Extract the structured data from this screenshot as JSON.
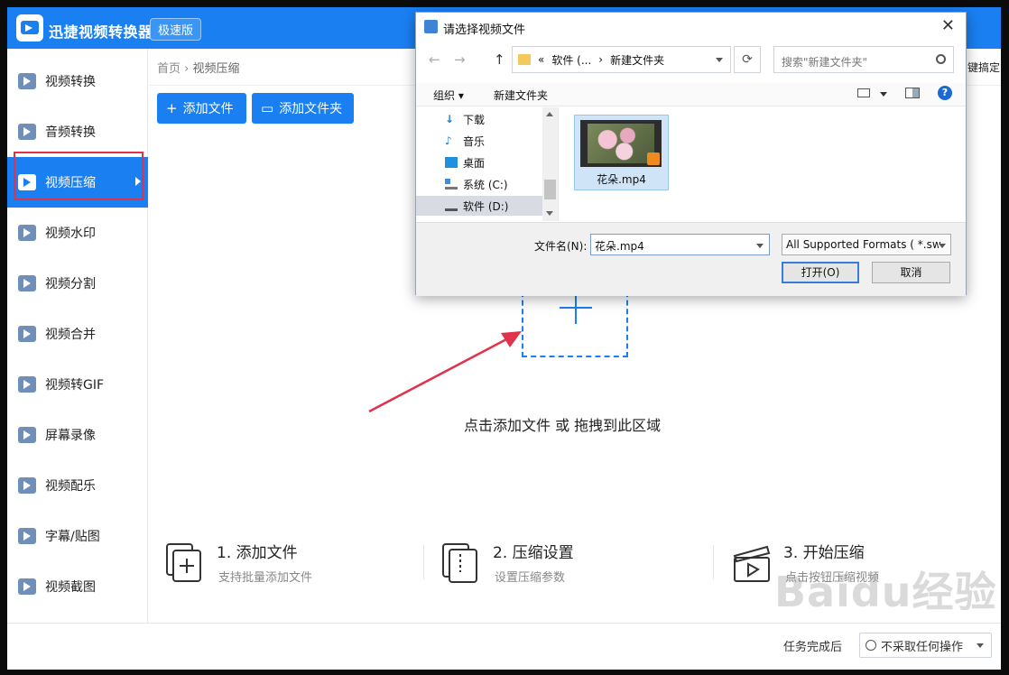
{
  "app": {
    "title": "迅捷视频转换器",
    "edition": "极速版"
  },
  "sidebar": {
    "items": [
      {
        "label": "视频转换"
      },
      {
        "label": "音频转换"
      },
      {
        "label": "视频压缩",
        "active": true
      },
      {
        "label": "视频水印"
      },
      {
        "label": "视频分割"
      },
      {
        "label": "视频合并"
      },
      {
        "label": "视频转GIF"
      },
      {
        "label": "屏幕录像"
      },
      {
        "label": "视频配乐"
      },
      {
        "label": "字幕/贴图"
      },
      {
        "label": "视频截图"
      }
    ],
    "active_outline_color": "#e0324a"
  },
  "breadcrumb": {
    "home": "首页",
    "sep": "›",
    "current": "视频压缩"
  },
  "toolbar": {
    "add_file": "添加文件",
    "add_folder": "添加文件夹",
    "right_cut_text": "键搞定"
  },
  "dropzone": {
    "text": "点击添加文件 或 拖拽到此区域"
  },
  "steps": [
    {
      "title": "1. 添加文件",
      "desc": "支持批量添加文件"
    },
    {
      "title": "2. 压缩设置",
      "desc": "设置压缩参数"
    },
    {
      "title": "3. 开始压缩",
      "desc": "点击按钮压缩视频"
    }
  ],
  "bottom": {
    "status_label": "任务完成后",
    "select_value": "不采取任何操作"
  },
  "watermark": "Baidu经验",
  "dialog": {
    "title": "请选择视频文件",
    "address": {
      "prefix": "«",
      "part1": "软件 (...",
      "sep": "›",
      "part2": "新建文件夹"
    },
    "search_placeholder": "搜索\"新建文件夹\"",
    "toolbar": {
      "organize": "组织 ▾",
      "new_folder": "新建文件夹",
      "help": "?"
    },
    "tree": [
      {
        "label": "下载",
        "icon": "download-icon"
      },
      {
        "label": "音乐",
        "icon": "music-icon"
      },
      {
        "label": "桌面",
        "icon": "desktop-icon"
      },
      {
        "label": "系统 (C:)",
        "icon": "drive-icon"
      },
      {
        "label": "软件 (D:)",
        "icon": "drive-icon",
        "selected": true
      }
    ],
    "file": {
      "name": "花朵.mp4"
    },
    "filename_label": "文件名(N):",
    "filename_value": "花朵.mp4",
    "filter": "All Supported Formats ( *.sw",
    "open": "打开(O)",
    "cancel": "取消"
  },
  "colors": {
    "accent": "#1a7ff0",
    "annotation": "#e0324a"
  }
}
